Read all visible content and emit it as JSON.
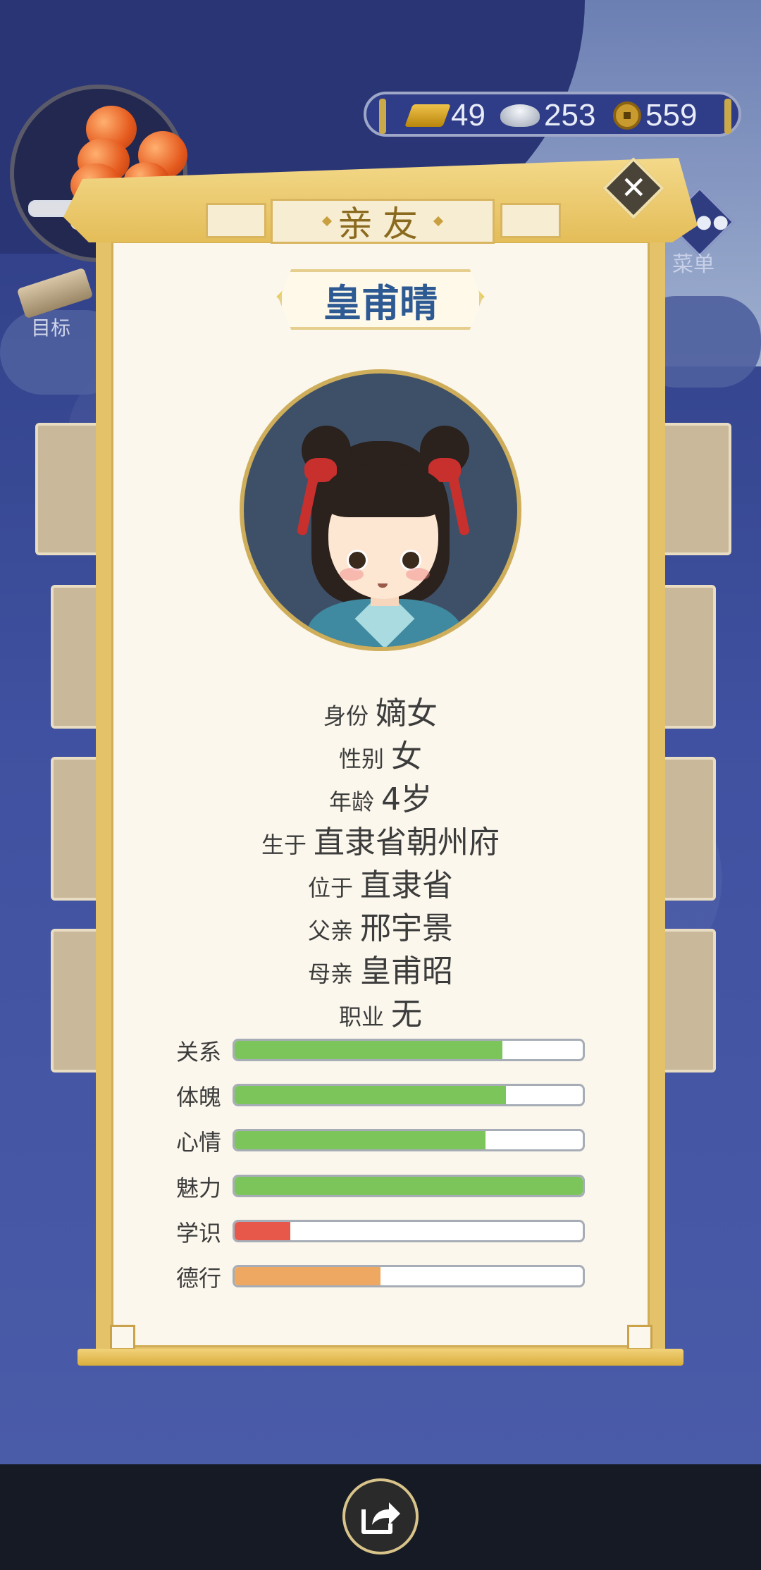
{
  "hud": {
    "goal_label": "目标",
    "menu_label": "菜单",
    "currency": [
      {
        "icon": "gold-bar-icon",
        "value": "49"
      },
      {
        "icon": "silver-ingot-icon",
        "value": "253"
      },
      {
        "icon": "copper-coin-icon",
        "value": "559"
      }
    ]
  },
  "modal": {
    "title": "亲友",
    "close_symbol": "✕",
    "character_name": "皇甫晴",
    "info": [
      {
        "label": "身份",
        "value": "嫡女"
      },
      {
        "label": "性别",
        "value": "女"
      },
      {
        "label": "年龄",
        "value": "4岁"
      },
      {
        "label": "生于",
        "value": "直隶省朝州府"
      },
      {
        "label": "位于",
        "value": "直隶省"
      },
      {
        "label": "父亲",
        "value": "邢宇景"
      },
      {
        "label": "母亲",
        "value": "皇甫昭"
      },
      {
        "label": "职业",
        "value": "无"
      }
    ],
    "stats": [
      {
        "label": "关系",
        "fraction": 0.77,
        "color": "#7cc55a"
      },
      {
        "label": "体魄",
        "fraction": 0.78,
        "color": "#7cc55a"
      },
      {
        "label": "心情",
        "fraction": 0.72,
        "color": "#7cc55a"
      },
      {
        "label": "魅力",
        "fraction": 1.0,
        "color": "#7cc55a"
      },
      {
        "label": "学识",
        "fraction": 0.16,
        "color": "#e8584a"
      },
      {
        "label": "德行",
        "fraction": 0.42,
        "color": "#eea862"
      }
    ]
  },
  "footer": {
    "share_icon": "share-icon"
  }
}
